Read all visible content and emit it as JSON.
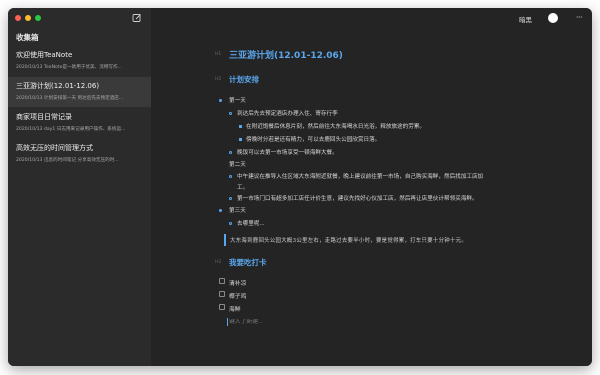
{
  "sidebar": {
    "title": "收集箱",
    "notes": [
      {
        "title": "欢迎使用TeaNote",
        "meta": "2020/10/13 TeaNote是一款用于优美、流畅写作..."
      },
      {
        "title": "三亚游计划(12.01-12.06)",
        "meta": "2020/10/13 计划安排第一天 到达后先去预定酒店..."
      },
      {
        "title": "商家项目日常记录",
        "meta": "2020/10/13 day1 日志用来记录用户操作、系统运..."
      },
      {
        "title": "高效无压的时间管理方式",
        "meta": "2020/10/13 迅息的时间笔记 分享高效无压的时..."
      }
    ]
  },
  "toolbar": {
    "theme_label": "暗黑",
    "more": "···"
  },
  "doc": {
    "h1_mark": "H1",
    "h2_mark": "H2",
    "title": "三亚游计划(12.01-12.06)",
    "section1": "计划安排",
    "items": {
      "day1": "第一天",
      "d1_a": "到达后先去预定酒店办理入住、寄存行李",
      "d1_a1": "在附近饱餐后休息片刻，然后前往大东海喝水日光浴，释放旅途的劳累。",
      "d1_a2": "傍晚时分若是还有精力，可以去鹿回头公园欣赏日落。",
      "d1_b": "晚饭可以去第一市场享受一顿海鲜大餐。",
      "day2_label": "第二天",
      "d2_a": "中午建议在推导入住区域大东海附近就餐，晚上建议前往第一市场，自己购买海鲜，然后找加工店加",
      "d2_a_cont": "工。",
      "d2_b": "第一市场门口有超多加工店任计价生意，建议先找好心仪加工店，然后再让店里伙计帮领买海鲜。",
      "day3": "第三天",
      "d3_a": "去哪里呢..."
    },
    "quote": "大东海到鹿回头公园大概3公里左右，走路过去要半小时，要是觉得累，打车只要十分钟十元。",
    "section2": "我要吃打卡",
    "todos": [
      "清补凉",
      "椰子鸡",
      "海鲜"
    ],
    "input_placeholder": "键入了新建..."
  }
}
